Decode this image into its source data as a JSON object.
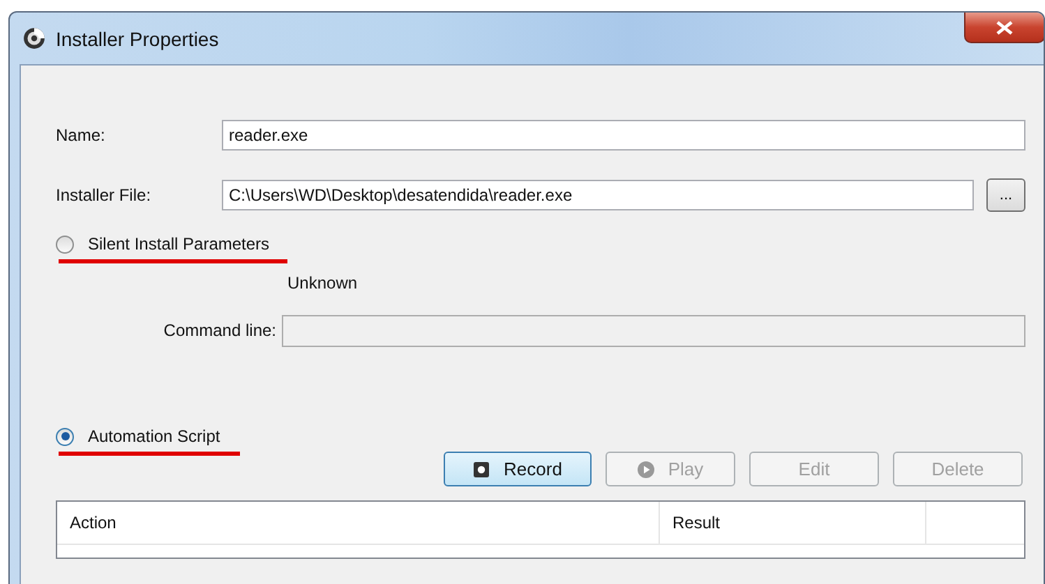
{
  "window": {
    "title": "Installer Properties"
  },
  "fields": [
    {
      "label": "Name:",
      "value": "reader.exe"
    },
    {
      "label": "Installer File:",
      "value": "C:\\Users\\WD\\Desktop\\desatendida\\reader.exe",
      "browse": "..."
    }
  ],
  "modes": [
    {
      "label": "Silent Install Parameters",
      "selected": false,
      "underlined": true
    },
    {
      "label": "Automation Script",
      "selected": true,
      "underlined": true
    }
  ],
  "silent": {
    "status": "Unknown",
    "command_label": "Command line:",
    "disabled": true
  },
  "buttons": [
    {
      "label": "Record",
      "kind": "record",
      "disabled": false,
      "focused": true
    },
    {
      "label": "Play",
      "kind": "play",
      "disabled": true,
      "focused": false
    },
    {
      "label": "Edit",
      "kind": "text",
      "disabled": true,
      "focused": false
    },
    {
      "label": "Delete",
      "kind": "text",
      "disabled": true,
      "focused": false
    }
  ],
  "table": {
    "columns": [
      "Action",
      "Result"
    ]
  }
}
